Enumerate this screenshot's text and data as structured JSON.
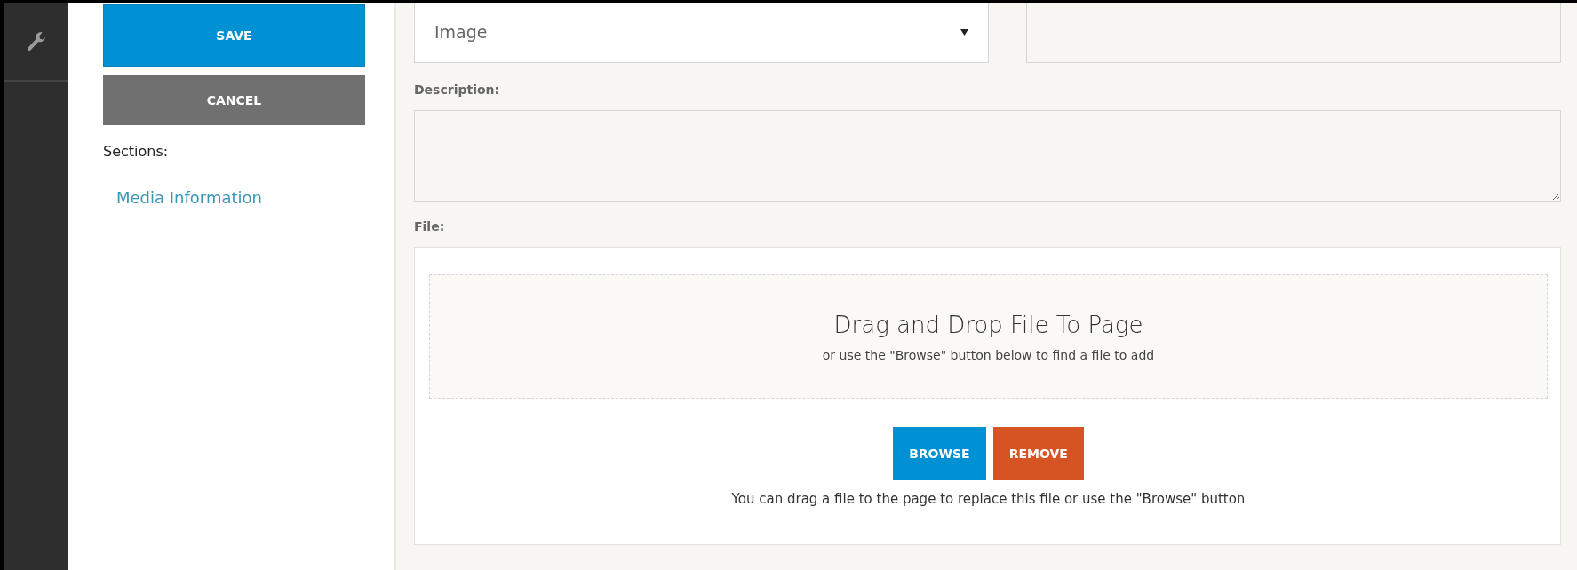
{
  "actions": [
    {
      "label": "SAVE",
      "kind": "primary"
    },
    {
      "label": "CANCEL",
      "kind": "secondary"
    }
  ],
  "sections": {
    "title": "Sections:",
    "items": [
      {
        "label": "Media Information"
      }
    ]
  },
  "form": {
    "type_select": {
      "value": "Image"
    },
    "description": {
      "label": "Description:"
    },
    "file": {
      "label": "File:",
      "dropzone": {
        "title": "Drag and Drop File To Page",
        "hint": "or use the \"Browse\" button below to find a file to add"
      },
      "buttons": [
        {
          "label": "BROWSE",
          "kind": "browse"
        },
        {
          "label": "REMOVE",
          "kind": "remove"
        }
      ],
      "note": "You can drag a file to the page to replace this file or use the \"Browse\" button"
    }
  }
}
